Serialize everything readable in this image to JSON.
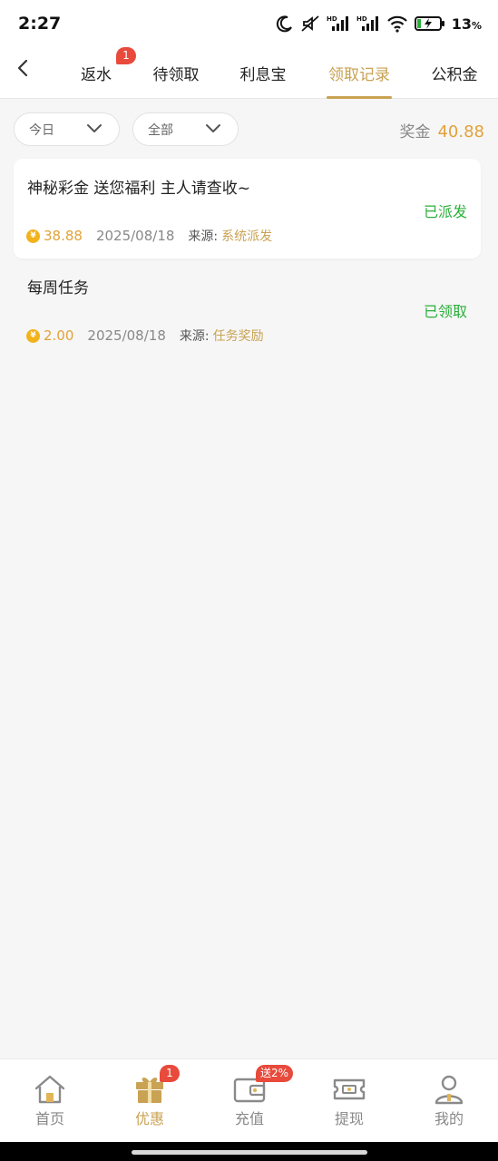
{
  "status_bar": {
    "time": "2:27",
    "battery_percent": "13",
    "battery_unit": "%",
    "icons": [
      "moon-icon",
      "mute-vibrate-icon",
      "hd-signal-icon",
      "hd-signal-icon",
      "wifi-icon",
      "battery-charging-icon"
    ]
  },
  "header": {
    "back_icon": "chevron-left-icon",
    "tabs": [
      {
        "label": "返水",
        "badge": "1"
      },
      {
        "label": "待领取"
      },
      {
        "label": "利息宝"
      },
      {
        "label": "领取记录",
        "active": true
      },
      {
        "label": "公积金"
      }
    ]
  },
  "filters": {
    "date_filter": "今日",
    "type_filter": "全部",
    "prize_label": "奖金",
    "prize_total": "40.88"
  },
  "records": [
    {
      "title": "神秘彩金 送您福利 主人请查收~",
      "status": "已派发",
      "currency_symbol": "¥",
      "amount": "38.88",
      "date": "2025/08/18",
      "source_label": "来源:",
      "source_value": "系统派发"
    },
    {
      "title": "每周任务",
      "status": "已领取",
      "currency_symbol": "¥",
      "amount": "2.00",
      "date": "2025/08/18",
      "source_label": "来源:",
      "source_value": "任务奖励"
    }
  ],
  "bottom_nav": [
    {
      "label": "首页",
      "icon": "home-icon"
    },
    {
      "label": "优惠",
      "icon": "gift-icon",
      "badge": "1",
      "active": true
    },
    {
      "label": "充值",
      "icon": "wallet-icon",
      "badge": "送2%"
    },
    {
      "label": "提现",
      "icon": "ticket-icon"
    },
    {
      "label": "我的",
      "icon": "user-icon"
    }
  ],
  "colors": {
    "accent_gold": "#c9a253",
    "amount_orange": "#e2a23a",
    "status_green": "#2aaf3a",
    "badge_red": "#e84a3b"
  }
}
